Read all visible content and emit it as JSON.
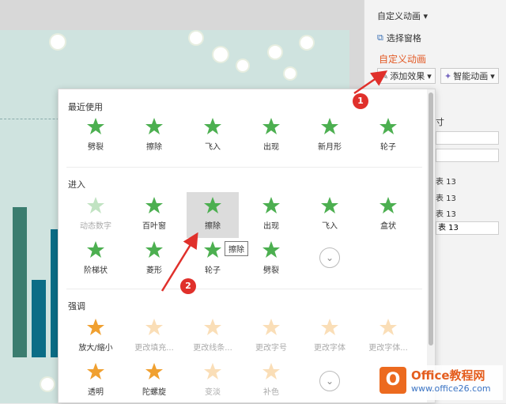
{
  "panel": {
    "title": "自定义动画",
    "select_pane": "选择窗格",
    "heading": "自定义动画",
    "add_effect": "添加效果",
    "smart_anim": "智能动画",
    "partial_label": "寸",
    "rows": [
      "表 13",
      "表 13",
      "表 13",
      "表 13"
    ]
  },
  "gallery": {
    "recent": {
      "title": "最近使用",
      "items": [
        "劈裂",
        "擦除",
        "飞入",
        "出现",
        "新月形",
        "轮子"
      ]
    },
    "entrance": {
      "title": "进入",
      "row1": [
        "动态数字",
        "百叶窗",
        "擦除",
        "出现",
        "飞入",
        "盒状"
      ],
      "row2": [
        "阶梯状",
        "菱形",
        "轮子",
        "劈裂"
      ]
    },
    "emphasis": {
      "title": "强调",
      "row1": [
        "放大/缩小",
        "更改填充...",
        "更改线条...",
        "更改字号",
        "更改字体",
        "更改字体..."
      ],
      "row2": [
        "透明",
        "陀螺旋",
        "变淡",
        "补色"
      ]
    },
    "tooltip": "擦除"
  },
  "badges": [
    "1",
    "2"
  ],
  "colors": {
    "accent": "#e35a25",
    "star_green": "#4caf50",
    "star_orange": "#f0a030",
    "badge_red": "#e0302b"
  },
  "logo": {
    "mark": "O",
    "name": "Office教程网",
    "url": "www.office26.com"
  }
}
